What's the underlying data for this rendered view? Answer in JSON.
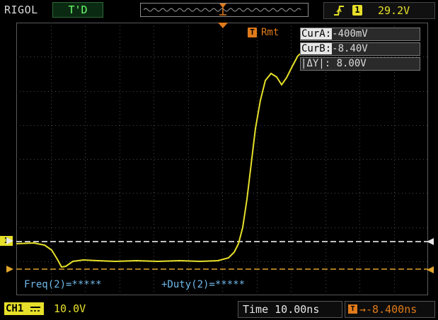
{
  "header": {
    "brand": "RIGOL",
    "trigger_status": "T'D",
    "trigger_edge_icon": "rising-edge-icon",
    "trigger_source": "1",
    "trigger_level": "29.2V"
  },
  "cursor_panel": {
    "marker_label": "T",
    "mode_label": "Rmt",
    "cur_a_tag": "CurA:",
    "cur_a_value": "-400mV",
    "cur_b_tag": "CurB:",
    "cur_b_value": "-8.40V",
    "delta_y": "|ΔY|: 8.00V"
  },
  "measurements": {
    "freq": "Freq(2)=*****",
    "duty": "+Duty(2)=*****"
  },
  "footer": {
    "channel_label": "CH1",
    "channel_coupling_icon": "dc-coupling-icon",
    "channel_scale": "10.0V",
    "time_label": "Time 10.00ns",
    "offset_icon_label": "T",
    "offset_value": "→-8.400ns"
  },
  "markers": {
    "channel1_ground": "1"
  },
  "colors": {
    "trace": "#e6e02a",
    "cursor_a": "#ffffff",
    "cursor_b": "#e0a52a",
    "trigger": "#e07a1b",
    "measurement": "#6fb8e8",
    "grid": "#3a3a3a"
  }
}
